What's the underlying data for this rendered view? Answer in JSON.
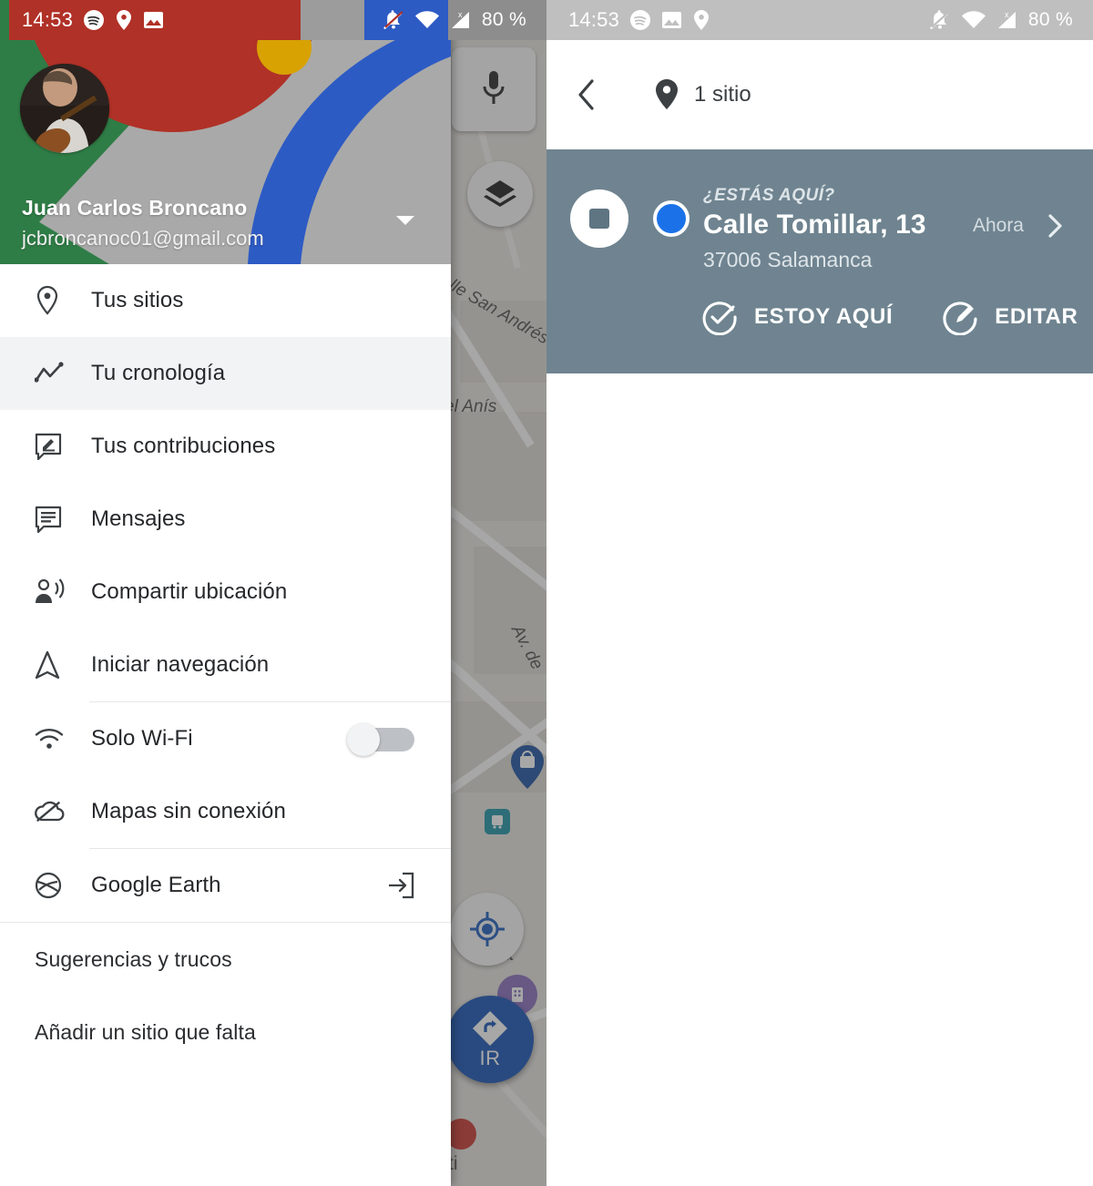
{
  "left_phone": {
    "status_bar": {
      "time": "14:53",
      "battery": "80 %",
      "icons": [
        "spotify-icon",
        "location-pin-icon",
        "image-icon",
        "notifications-off-icon",
        "wifi-icon",
        "signal-no-sim-icon"
      ]
    },
    "account": {
      "name": "Juan Carlos Broncano",
      "email": "jcbroncanoc01@gmail.com",
      "expand_icon": "chevron-down-icon",
      "avatar_alt": "profile-photo"
    },
    "menu_primary": [
      {
        "id": "tus-sitios",
        "label": "Tus sitios",
        "icon": "location-pin-icon",
        "selected": false
      },
      {
        "id": "tu-cronologia",
        "label": "Tu cronología",
        "icon": "timeline-icon",
        "selected": true
      },
      {
        "id": "tus-contribuciones",
        "label": "Tus contribuciones",
        "icon": "review-edit-icon",
        "selected": false
      },
      {
        "id": "mensajes",
        "label": "Mensajes",
        "icon": "message-icon",
        "selected": false
      },
      {
        "id": "compartir-ubicacion",
        "label": "Compartir ubicación",
        "icon": "person-share-icon",
        "selected": false
      },
      {
        "id": "iniciar-navegacion",
        "label": "Iniciar navegación",
        "icon": "navigation-arrow-icon",
        "selected": false
      }
    ],
    "menu_settings": [
      {
        "id": "solo-wifi",
        "label": "Solo Wi-Fi",
        "icon": "wifi-icon",
        "toggle": true,
        "toggle_on": false
      },
      {
        "id": "mapas-sin-conexion",
        "label": "Mapas sin conexión",
        "icon": "cloud-off-icon",
        "toggle": false
      }
    ],
    "menu_apps": [
      {
        "id": "google-earth",
        "label": "Google Earth",
        "icon": "earth-globe-icon",
        "trailing_icon": "open-external-icon"
      }
    ],
    "menu_footer": [
      {
        "id": "sugerencias-y-trucos",
        "label": "Sugerencias y trucos"
      },
      {
        "id": "anadir-un-sitio-que-falta",
        "label": "Añadir un sitio que falta"
      }
    ],
    "map": {
      "labels": [
        "lle San Andrés",
        "el Anís",
        "Av. de",
        "xa",
        "ti"
      ],
      "controls": [
        {
          "id": "voice-search",
          "icon": "microphone-icon"
        },
        {
          "id": "map-layers",
          "icon": "layers-icon"
        },
        {
          "id": "my-location",
          "icon": "my-location-icon"
        },
        {
          "id": "directions-go",
          "icon": "directions-icon",
          "label": "IR"
        }
      ]
    }
  },
  "right_phone": {
    "status_bar": {
      "time": "14:53",
      "battery": "80 %",
      "icons": [
        "spotify-icon",
        "image-icon",
        "location-pin-icon",
        "notifications-off-icon",
        "wifi-icon",
        "signal-no-sim-icon"
      ]
    },
    "app_bar": {
      "back_icon": "back-arrow-icon",
      "pin_icon": "location-pin-icon",
      "title": "1 sitio"
    },
    "place_card": {
      "eyebrow": "¿ESTÁS AQUÍ?",
      "title": "Calle Tomillar, 13",
      "subtitle": "37006 Salamanca",
      "time": "Ahora",
      "stop_icon": "stop-recording-icon",
      "dot_icon": "blue-location-dot-icon",
      "chevron_icon": "chevron-right-icon",
      "background_color": "#6f8490",
      "actions": [
        {
          "id": "estoy-aqui",
          "label": "ESTOY AQUÍ",
          "icon": "check-circle-icon"
        },
        {
          "id": "editar",
          "label": "EDITAR",
          "icon": "edit-circle-icon"
        }
      ]
    }
  },
  "colors": {
    "accent_blue": "#1b72e8",
    "card_slate": "#6f8490",
    "selected_row": "#f1f3f4",
    "text_primary": "#25272a",
    "text_secondary": "#70757a",
    "google_red": "#b03127",
    "google_green": "#2f7d46",
    "google_blue": "#2d5bc4",
    "google_yellow": "#d8a202"
  }
}
